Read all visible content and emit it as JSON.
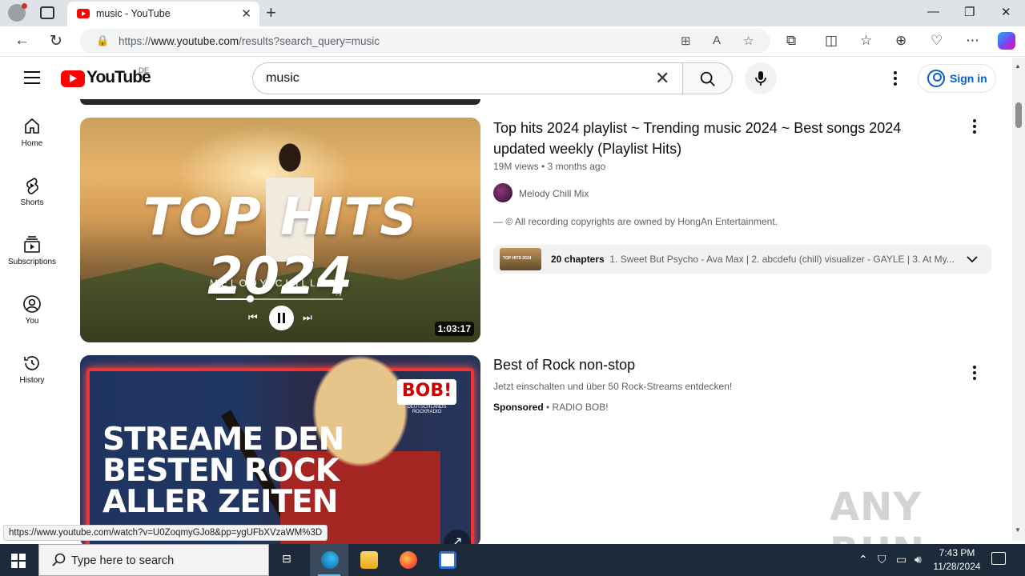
{
  "browser": {
    "tab_title": "music - YouTube",
    "url_prefix": "https://",
    "url_host": "www.youtube.com",
    "url_path": "/results?search_query=music",
    "status_url": "https://www.youtube.com/watch?v=U0ZoqmyGJo8&pp=ygUFbXVzaWM%3D"
  },
  "header": {
    "logo_text": "YouTube",
    "country_code": "DE",
    "search_value": "music",
    "sign_in_label": "Sign in"
  },
  "sidebar": {
    "items": [
      {
        "label": "Home",
        "icon": "home-icon"
      },
      {
        "label": "Shorts",
        "icon": "shorts-icon"
      },
      {
        "label": "Subscriptions",
        "icon": "subscriptions-icon"
      },
      {
        "label": "You",
        "icon": "you-icon"
      },
      {
        "label": "History",
        "icon": "history-icon"
      }
    ]
  },
  "results": [
    {
      "title": "Top hits 2024 playlist ~ Trending music 2024 ~ Best songs 2024 updated weekly (Playlist Hits)",
      "views": "19M views",
      "age": "3 months ago",
      "channel": "Melody Chill Mix",
      "description": "— © All recording copyrights are owned by HongAn Entertainment.",
      "duration": "1:03:17",
      "thumb_text": "TOP HITS 2024",
      "thumb_sub": "MELODY CHILL MIX",
      "chapters_count": "20 chapters",
      "chapters_list": "1. Sweet But Psycho - Ava Max | 2. abcdefu (chill) visualizer - GAYLE | 3. At My..."
    },
    {
      "title": "Best of Rock non-stop",
      "description": "Jetzt einschalten und über 50 Rock-Streams entdecken!",
      "sponsored_label": "Sponsored",
      "advertiser": "RADIO BOB!",
      "thumb_badge": "BOB!",
      "thumb_badge_sub": "DEUTSCHLANDS ROCKRADIO",
      "thumb_line1": "STREAME DEN",
      "thumb_line2": "BESTEN ROCK",
      "thumb_line3": "ALLER ZEITEN"
    }
  ],
  "watermark": "ANY RUN",
  "taskbar": {
    "search_placeholder": "Type here to search",
    "time": "7:43 PM",
    "date": "11/28/2024"
  },
  "colors": {
    "youtube_red": "#ff0000",
    "link_blue": "#065fd4",
    "taskbar_bg": "#1c2a3a"
  }
}
